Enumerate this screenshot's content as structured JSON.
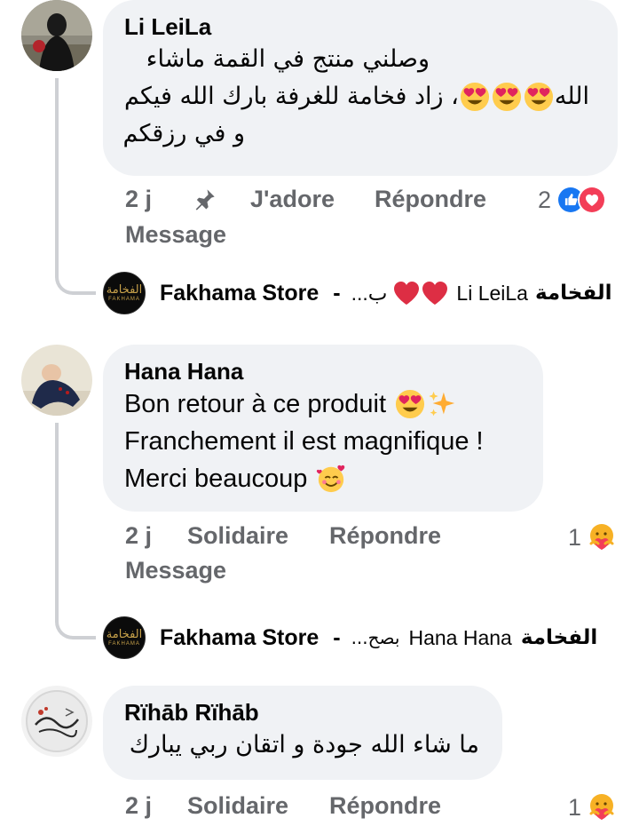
{
  "comments": [
    {
      "author": "Li LeiLa",
      "text_lines": [
        "وصلني منتج في القمة  ماشاء",
        "الله",
        "، زاد فخامة للغرفة بارك الله فيكم",
        "و في رزقكم"
      ],
      "time": "2 j",
      "pin_icon": "pin-icon",
      "reaction_label": "J'adore",
      "reply_label": "Répondre",
      "message_label": "Message",
      "reaction_count": "2",
      "reaction_icons": [
        "like-icon",
        "love-icon"
      ],
      "reply": {
        "author": "Fakhama Store",
        "separator": "-",
        "snippet_brand": "الفخامة",
        "snippet_mention": "Li LeiLa",
        "snippet_tail": "ب..."
      }
    },
    {
      "author": "Hana Hana",
      "text_lines": [
        "Bon retour à ce produit",
        "Franchement il est magnifique !",
        "Merci beaucoup"
      ],
      "time": "2 j",
      "reaction_label": "Solidaire",
      "reply_label": "Répondre",
      "message_label": "Message",
      "reaction_count": "1",
      "reaction_icons": [
        "care-icon"
      ],
      "reply": {
        "author": "Fakhama Store",
        "separator": "-",
        "snippet_brand": "الفخامة",
        "snippet_mention": "Hana Hana",
        "snippet_tail": "بصح..."
      }
    },
    {
      "author": "Rïhāb Rïhāb",
      "text_lines": [
        "ما شاء الله جودة و اتقان  ربي يبارك"
      ],
      "time": "2 j",
      "reaction_label": "Solidaire",
      "reply_label": "Répondre",
      "reaction_count": "1",
      "reaction_icons": [
        "care-icon"
      ]
    }
  ],
  "store_logo": {
    "arabic": "الفخامة",
    "latin": "FAKHAMA"
  },
  "colors": {
    "bubble": "#f0f2f5",
    "meta": "#65676b",
    "jadore": "#d93a3f",
    "solidaire": "#8a7a14",
    "like": "#1877f2",
    "love": "#f33e58"
  }
}
